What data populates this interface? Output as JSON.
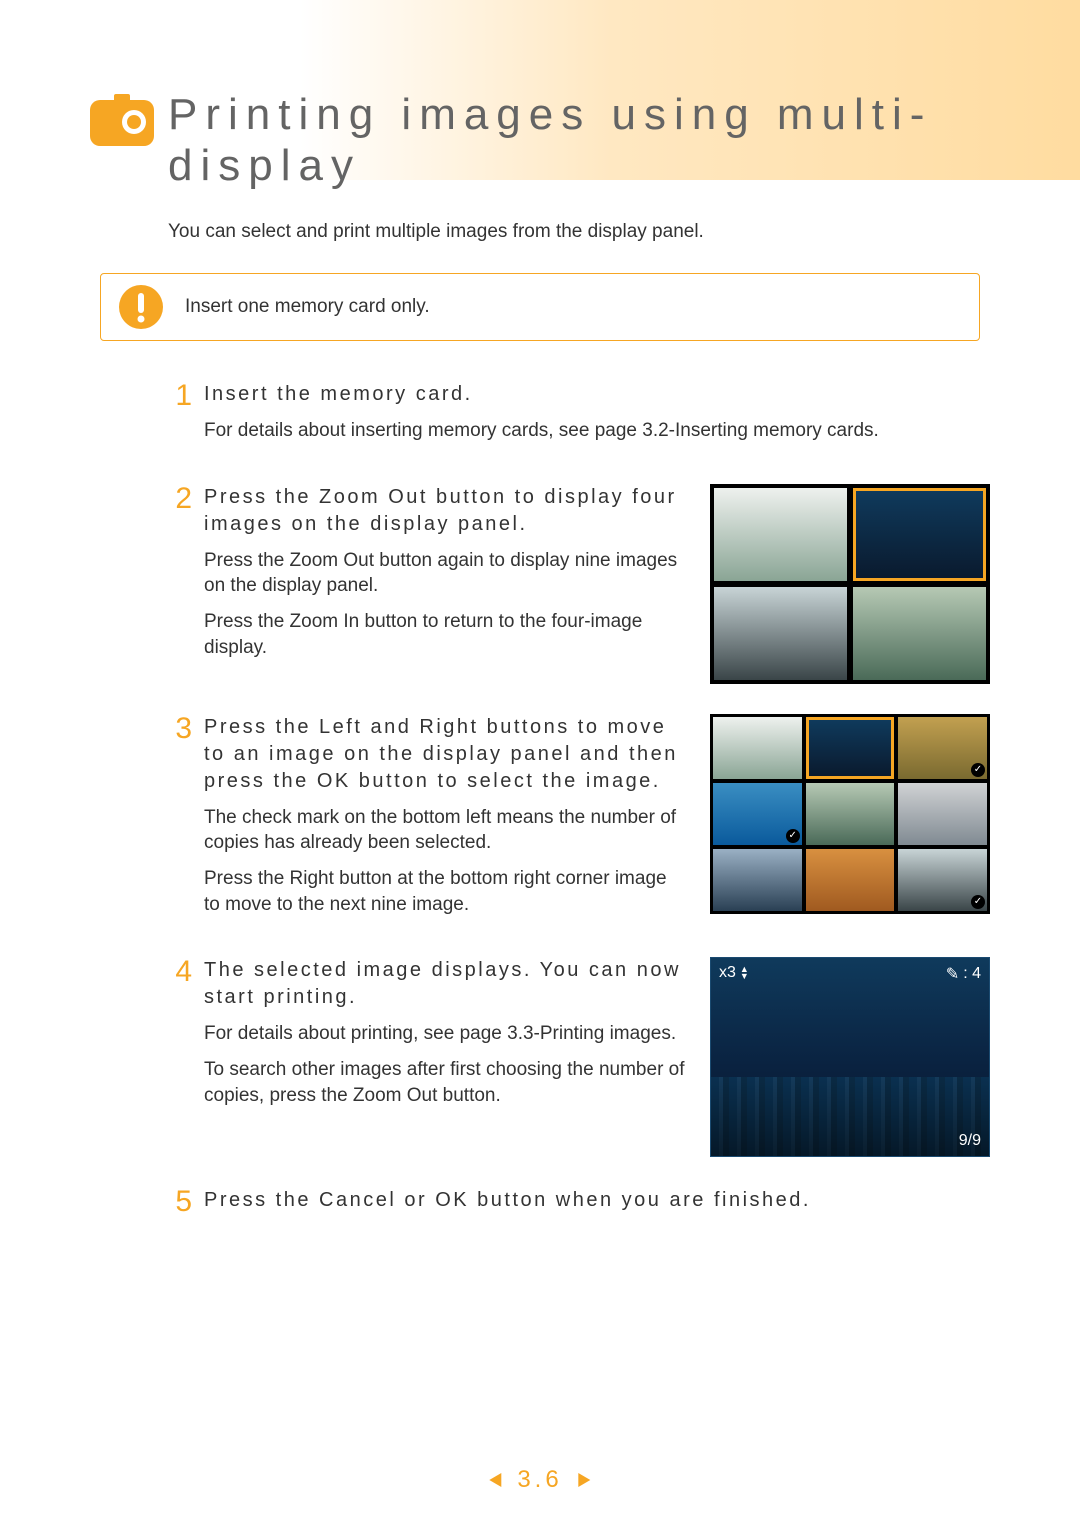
{
  "title": "Printing images using multi-display",
  "intro": "You can select and print multiple images from the display panel.",
  "warning": "Insert one memory card only.",
  "steps": [
    {
      "num": "1",
      "title": "Insert the memory card.",
      "details": [
        "For details about inserting memory cards, see page 3.2-Inserting memory cards."
      ]
    },
    {
      "num": "2",
      "title": "Press the Zoom Out button to display four images on the display panel.",
      "details": [
        "Press the Zoom Out button again to display nine images on the display panel.",
        "Press the Zoom In button to return to the four-image display."
      ]
    },
    {
      "num": "3",
      "title": "Press the Left and Right buttons to move to an image on the display panel and then press the OK button to select the image.",
      "details": [
        "The check mark on the bottom left means the number of copies has already been selected.",
        "Press the Right button at the bottom right corner image to move to the next nine image."
      ]
    },
    {
      "num": "4",
      "title": "The selected image displays. You can now start printing.",
      "details": [
        "For details about printing, see page 3.3-Printing images.",
        "To search other images after first choosing the number of copies, press the Zoom Out button."
      ]
    },
    {
      "num": "5",
      "title": "Press the Cancel or OK button when you are finished.",
      "details": []
    }
  ],
  "preview": {
    "copies_label": "x3",
    "print_count": ": 4",
    "position": "9/9"
  },
  "page_number": "3.6"
}
